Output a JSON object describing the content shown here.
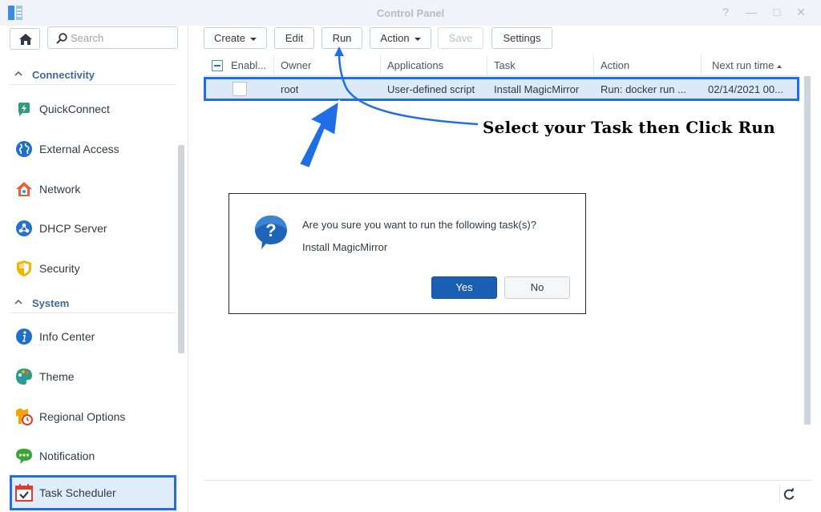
{
  "window": {
    "title": "Control Panel",
    "controls": [
      "?",
      "—",
      "□",
      "✕"
    ]
  },
  "sidebar": {
    "search_placeholder": "Search",
    "sections": [
      {
        "label": "Connectivity",
        "chevron": "^"
      },
      {
        "label": "System",
        "chevron": "^"
      }
    ],
    "items": [
      {
        "label": "QuickConnect",
        "icon": "quickconnect-icon"
      },
      {
        "label": "External Access",
        "icon": "globe-icon"
      },
      {
        "label": "Network",
        "icon": "network-house-icon"
      },
      {
        "label": "DHCP Server",
        "icon": "dhcp-icon"
      },
      {
        "label": "Security",
        "icon": "shield-icon"
      },
      {
        "label": "Info Center",
        "icon": "info-icon"
      },
      {
        "label": "Theme",
        "icon": "palette-icon"
      },
      {
        "label": "Regional Options",
        "icon": "regional-clock-icon"
      },
      {
        "label": "Notification",
        "icon": "chat-bubble-icon"
      },
      {
        "label": "Task Scheduler",
        "icon": "calendar-check-icon",
        "active": true
      }
    ]
  },
  "toolbar": {
    "create": "Create",
    "edit": "Edit",
    "run": "Run",
    "action": "Action",
    "save": "Save",
    "settings": "Settings"
  },
  "table": {
    "columns": [
      "Enabl...",
      "Owner",
      "Applications",
      "Task",
      "Action",
      "Next run time"
    ],
    "rows": [
      {
        "enabled": false,
        "owner": "root",
        "application": "User-defined script",
        "task": "Install MagicMirror",
        "action": "Run: docker run ...",
        "next_run": "02/14/2021 00..."
      }
    ]
  },
  "annotation": {
    "text": "Select your Task then Click Run"
  },
  "dialog": {
    "message": "Are you sure you want to run the following task(s)?",
    "task": "Install MagicMirror",
    "yes": "Yes",
    "no": "No"
  },
  "colors": {
    "accent": "#1f6ee6",
    "primary_button": "#1a5fb4",
    "selected_row": "#dbe9f9"
  }
}
